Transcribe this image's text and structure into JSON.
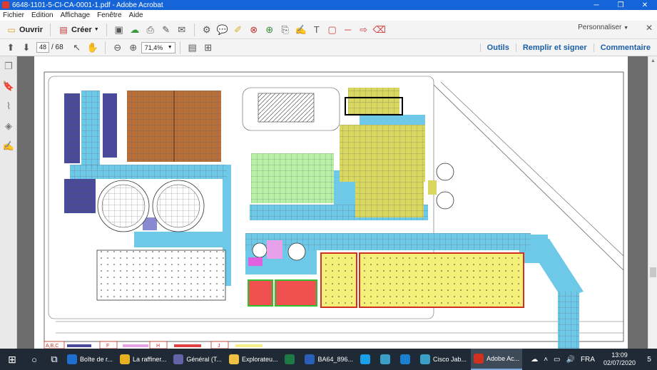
{
  "window": {
    "title": "6648-1101-5-CI-CA-0001-1.pdf - Adobe Acrobat",
    "minimize": "─",
    "maximize": "❐",
    "close": "✕"
  },
  "menu": [
    "Fichier",
    "Edition",
    "Affichage",
    "Fenêtre",
    "Aide"
  ],
  "toolbar": {
    "open_label": "Ouvrir",
    "create_label": "Créer",
    "customize_label": "Personnaliser",
    "close_glyph": "✕"
  },
  "nav": {
    "current_page": "48",
    "page_sep": "/ 68",
    "zoom": "71,4%",
    "links": [
      "Outils",
      "Remplir et signer",
      "Commentaire"
    ]
  },
  "legend": {
    "labels": [
      "A,B,C",
      "F",
      "H",
      "J"
    ],
    "colors": [
      "#4a4a9a",
      "#e8a0e8",
      "#e04040",
      "#f5f08a"
    ]
  },
  "colors": {
    "blue_zone": "#6ec8e8",
    "navy_zone": "#4a4a9a",
    "brown_zone": "#b8703a",
    "green_zone": "#b8f0a8",
    "olive_zone": "#d8d860",
    "yellow_zone": "#f5f07a",
    "red_zone": "#f05050",
    "magenta_zone": "#e060e0",
    "accent": "#1565d8"
  },
  "taskbar": {
    "apps": [
      {
        "label": "Boîte de r...",
        "icon": "outlook-icon",
        "color": "#1f6fd0"
      },
      {
        "label": "La raffiner...",
        "icon": "chrome-icon",
        "color": "#e8b020"
      },
      {
        "label": "Général (T...",
        "icon": "teams-icon",
        "color": "#6264a7"
      },
      {
        "label": "Explorateu...",
        "icon": "folder-icon",
        "color": "#f0c040"
      },
      {
        "label": "",
        "icon": "excel-icon",
        "color": "#1e7a45"
      },
      {
        "label": "BA64_896...",
        "icon": "word-icon",
        "color": "#2b5eb8"
      },
      {
        "label": "",
        "icon": "skype-icon",
        "color": "#1aa0e8"
      },
      {
        "label": "",
        "icon": "webex-icon",
        "color": "#3aa0c8"
      },
      {
        "label": "",
        "icon": "edge-icon",
        "color": "#1a80d0"
      },
      {
        "label": "Cisco Jab...",
        "icon": "jabber-icon",
        "color": "#3aa0c8"
      },
      {
        "label": "Adobe Ac...",
        "icon": "acrobat-icon",
        "color": "#d03020"
      }
    ],
    "lang": "FRA",
    "time": "13:09",
    "date": "02/07/2020",
    "notifications": "5"
  }
}
